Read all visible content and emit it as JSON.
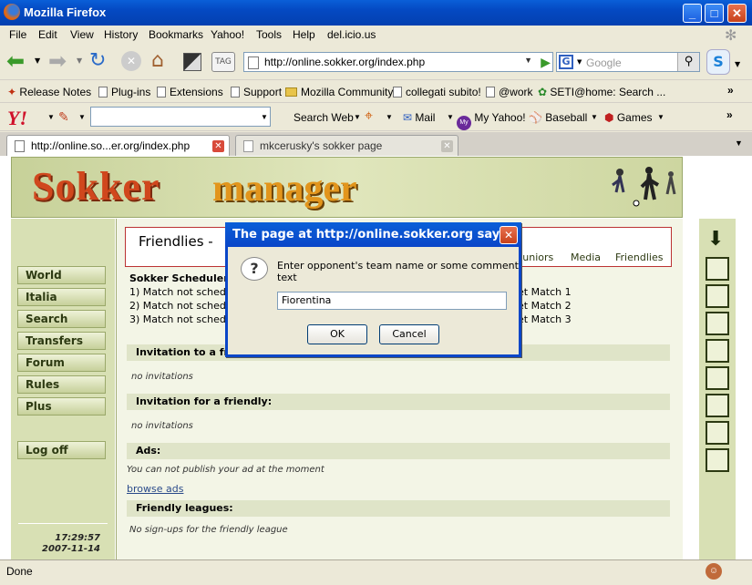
{
  "window": {
    "title": "Mozilla Firefox"
  },
  "menu": {
    "file": "File",
    "edit": "Edit",
    "view": "View",
    "history": "History",
    "bookmarks": "Bookmarks",
    "yahoo": "Yahoo!",
    "tools": "Tools",
    "help": "Help",
    "delicious": "del.icio.us"
  },
  "nav": {
    "url": "http://online.sokker.org/index.php",
    "search_placeholder": "Google",
    "tag_label": "TAG"
  },
  "bookmarks": [
    "Release Notes",
    "Plug-ins",
    "Extensions",
    "Support",
    "Mozilla Community",
    "collegati subito!",
    "@work",
    "SETI@home: Search ..."
  ],
  "yahoo_toolbar": {
    "search_web": "Search Web",
    "mail": "Mail",
    "my_yahoo": "My Yahoo!",
    "baseball": "Baseball",
    "games": "Games",
    "my_badge": "My"
  },
  "tabs": [
    {
      "label": "http://online.so...er.org/index.php"
    },
    {
      "label": "mkcerusky's sokker page"
    }
  ],
  "site": {
    "logo_left": "Sokker",
    "logo_right": "manager"
  },
  "leftnav": {
    "items": [
      "World",
      "Italia",
      "Search",
      "Transfers",
      "Forum",
      "Rules",
      "Plus"
    ],
    "logoff": "Log off",
    "time": "17:29:57",
    "date": "2007-11-14"
  },
  "content": {
    "heading": "Friendlies -",
    "subtabs": [
      "Juniors",
      "Media",
      "Friendlies"
    ],
    "scheduler_title": "Sokker Scheduler (",
    "schedule_rows": [
      "1) Match not sched",
      "2) Match not sched",
      "3) Match not sched"
    ],
    "schedule_right": [
      "et Match 1",
      "et Match 2",
      "et Match 3"
    ],
    "sec_invitation_to": "Invitation to a fri",
    "no_inv_1": "no invitations",
    "sec_invitation_for": "Invitation for a friendly:",
    "no_inv_2": "no invitations",
    "sec_ads": "Ads:",
    "ads_text": "You can not publish your ad at the moment",
    "browse_ads": "browse ads",
    "sec_leagues": "Friendly leagues:",
    "leagues_text": "No sign-ups for the friendly league"
  },
  "dialog": {
    "title": "The page at http://online.sokker.org says:",
    "prompt": "Enter opponent's team name or some comment text",
    "value": "Fiorentina",
    "ok": "OK",
    "cancel": "Cancel",
    "icon_glyph": "?"
  },
  "status": {
    "text": "Done"
  },
  "colors": {
    "titlebar": "#0a5fd8",
    "site_green": "#d8e0b4",
    "logo_red": "#d0471d",
    "logo_orange": "#e2951c"
  }
}
